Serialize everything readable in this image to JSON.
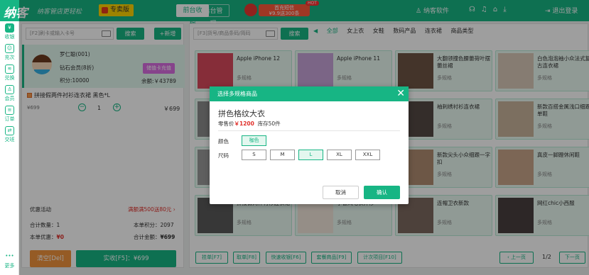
{
  "topbar": {
    "logo": "纳客",
    "slogan": "纳客管店更轻松",
    "special_tag": "专卖版",
    "tabs": [
      "前台收银",
      "后台管理"
    ],
    "promo_line1": "首充短信",
    "promo_line2": "¥9.9送300条",
    "promo_hot": "HOT",
    "username": "纳客软件",
    "logout": "退出登录"
  },
  "sidebar": [
    {
      "label": "收银",
      "icon": "cashier-icon",
      "glyph": "¥"
    },
    {
      "label": "充次",
      "icon": "recharge-times-icon",
      "glyph": "☺"
    },
    {
      "label": "兑换",
      "icon": "exchange-icon",
      "glyph": "≋"
    },
    {
      "label": "会员",
      "icon": "member-icon",
      "glyph": "♙"
    },
    {
      "label": "订单",
      "icon": "order-icon",
      "glyph": "≡"
    },
    {
      "label": "交班",
      "icon": "shift-icon",
      "glyph": "⇄"
    },
    {
      "label": "更多",
      "icon": "more-icon",
      "glyph": "•••"
    }
  ],
  "left": {
    "card_input_placeholder": "[F2]刷卡或输入卡号",
    "search": "搜索",
    "add_new": "+新增",
    "member": {
      "name": "罗仁聪(001)",
      "level": "钻石会员(8折)",
      "points": "积分:10000",
      "recharge_btn": "储值卡充值",
      "balance": "余额:￥43789"
    },
    "item": {
      "name": "拼接假两件衬衫连衣裙 黑色*L",
      "price": "¥699",
      "qty": "1",
      "subtotal": "￥699"
    },
    "promo_label": "优惠活动",
    "promo_value": "满额满500送80元",
    "count_label": "合计数量：1",
    "points_label": "本单积分：2097",
    "discount_label": "本单优惠：",
    "discount_value": "¥0",
    "total_label": "合计金额：",
    "total_value": "¥699",
    "clear_btn": "清空[Del]",
    "pay_btn": "实收[F5]：¥699"
  },
  "right": {
    "search_placeholder": "[F3]货号/商品条码/简码",
    "search": "搜索",
    "categories": [
      "全部",
      "女上衣",
      "女鞋",
      "数码产品",
      "连衣裙",
      "商品类型"
    ],
    "products": [
      {
        "name": "Apple iPhone 12",
        "spec": "多规格",
        "color": "#d94a5c"
      },
      {
        "name": "Apple iPhone 11",
        "spec": "多规格",
        "color": "#c7a3d9"
      },
      {
        "name": "大翻领撞色腰蕾荷叶摆蕾丝裙",
        "spec": "多规格",
        "color": "#6e5544"
      },
      {
        "name": "白色泡泡袖小众法式复古连衣裙",
        "spec": "多规格",
        "color": "#d8c9b8"
      },
      {
        "name": "",
        "spec": "",
        "color": "#8b8b8b"
      },
      {
        "name": "",
        "spec": "",
        "color": "#a9a9a9"
      },
      {
        "name": "袖刺绣衬衫连衣裙",
        "spec": "多规格",
        "color": "#544a44"
      },
      {
        "name": "新款百搭金属浅口细跟单鞋",
        "spec": "多规格",
        "color": "#c9b39b"
      },
      {
        "name": "",
        "spec": "",
        "color": "#9a9a9a"
      },
      {
        "name": "",
        "spec": "",
        "color": "#b0b0b0"
      },
      {
        "name": "新款尖头小众细跟一字扣",
        "spec": "多规格",
        "color": "#b08d72"
      },
      {
        "name": "真皮一脚蹬休闲鞋",
        "spec": "多规格",
        "color": "#c8a58a"
      },
      {
        "name": "拼接假两件衬衫连衣裙",
        "spec": "多规格",
        "color": "#5a5a5a"
      },
      {
        "name": "小香风毛衣开衫",
        "spec": "多规格",
        "color": "#f0e6da"
      },
      {
        "name": "连帽卫衣新款",
        "spec": "多规格",
        "color": "#7d6a60"
      },
      {
        "name": "网红chic小西服",
        "spec": "多规格",
        "color": "#4a4040"
      }
    ],
    "bottom_btns": [
      "挂单[F7]",
      "取单[F8]",
      "快速收银[F6]",
      "套餐商品[F9]",
      "计次项目[F10]"
    ],
    "prev": "上一页",
    "page": "1/2",
    "next": "下一页"
  },
  "modal": {
    "title": "选择多规格商品",
    "product": "拼色格纹大衣",
    "price_label": "零售价",
    "price": "￥1200",
    "stock": "库存50件",
    "color_label": "颜色",
    "colors": [
      "咖色"
    ],
    "size_label": "尺码",
    "sizes": [
      "S",
      "M",
      "L",
      "XL",
      "XXL"
    ],
    "cancel": "取消",
    "confirm": "确认"
  },
  "colors": {
    "accent": "#17b584",
    "red": "#e0302a"
  }
}
